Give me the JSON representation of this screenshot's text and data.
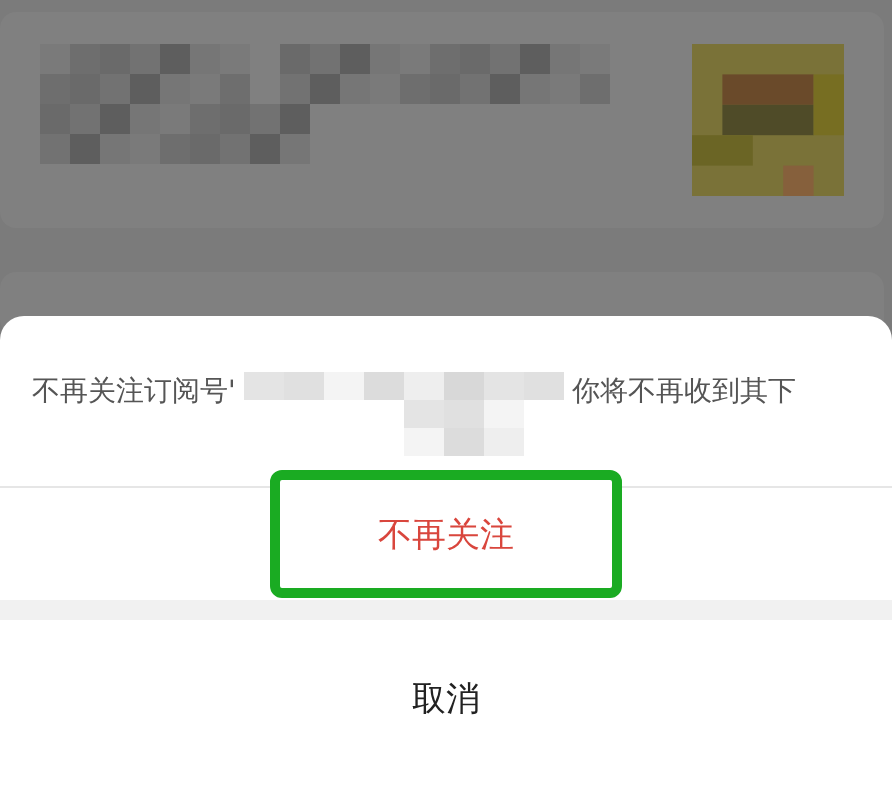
{
  "sheet": {
    "message_start": "不再关注订阅号'",
    "message_end": "你将不再收到其下",
    "actions": [
      {
        "label": "不再关注",
        "kind": "destructive",
        "highlighted": true
      }
    ],
    "cancel": "取消"
  }
}
